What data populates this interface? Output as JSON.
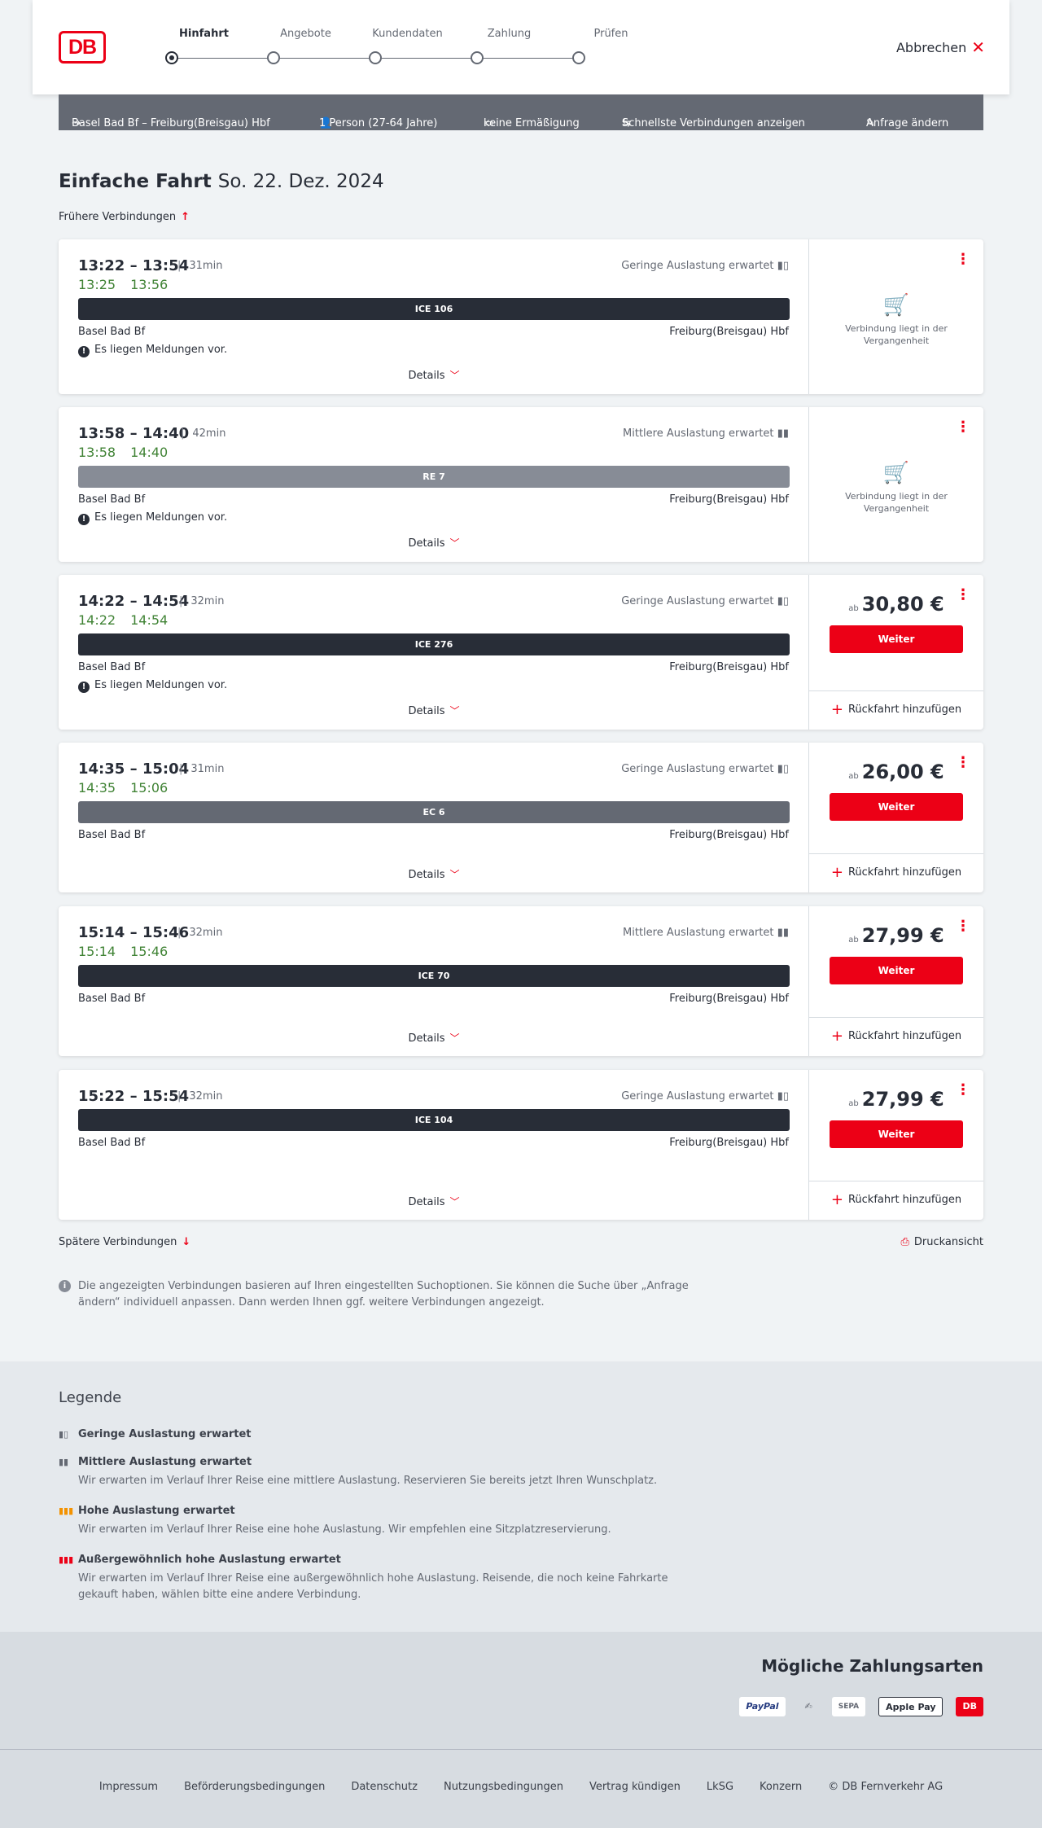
{
  "header": {
    "logo": "DB",
    "steps": [
      "Hinfahrt",
      "Angebote",
      "Kundendaten",
      "Zahlung",
      "Prüfen"
    ],
    "cancel_label": "Abbrechen"
  },
  "query": {
    "route": "Basel Bad Bf – Freiburg(Breisgau) Hbf",
    "passengers": "1 Person (27-64 Jahre)",
    "discount": "keine Ermäßigung",
    "fastest": "Schnellste Verbindungen anzeigen",
    "change": "Anfrage ändern"
  },
  "page": {
    "title": "Einfache Fahrt",
    "date": "So. 22. Dez. 2024",
    "earlier": "Frühere Verbindungen",
    "later": "Spätere Verbindungen",
    "print": "Druckansicht",
    "info": "Die angezeigten Verbindungen basieren auf Ihren eingestellten Suchoptionen. Sie können die Suche über „Anfrage ändern“ individuell anpassen. Dann werden Ihnen ggf. weitere Verbindungen angezeigt."
  },
  "common": {
    "details": "Details",
    "weiter": "Weiter",
    "return": "Rückfahrt hinzufügen",
    "past": "Verbindung liegt in der Vergangenheit",
    "ab": "ab",
    "message": "Es liegen Meldungen vor."
  },
  "connections": [
    {
      "times": "13:22 – 13:54",
      "duration": "31min",
      "rt_dep": "13:25",
      "rt_arr": "13:56",
      "load": "Geringe Auslastung erwartet",
      "train": "ICE 106",
      "from": "Basel Bad Bf",
      "to": "Freiburg(Breisgau) Hbf"
    },
    {
      "times": "13:58 – 14:40",
      "duration": "42min",
      "rt_dep": "13:58",
      "rt_arr": "14:40",
      "load": "Mittlere Auslastung erwartet",
      "train": "RE 7",
      "from": "Basel Bad Bf",
      "to": "Freiburg(Breisgau) Hbf"
    },
    {
      "times": "14:22 – 14:54",
      "duration": "32min",
      "rt_dep": "14:22",
      "rt_arr": "14:54",
      "load": "Geringe Auslastung erwartet",
      "train": "ICE 276",
      "from": "Basel Bad Bf",
      "to": "Freiburg(Breisgau) Hbf",
      "price": "30,80 €"
    },
    {
      "times": "14:35 – 15:04",
      "duration": "31min",
      "rt_dep": "14:35",
      "rt_arr": "15:06",
      "load": "Geringe Auslastung erwartet",
      "train": "EC 6",
      "from": "Basel Bad Bf",
      "to": "Freiburg(Breisgau) Hbf",
      "price": "26,00 €"
    },
    {
      "times": "15:14 – 15:46",
      "duration": "32min",
      "rt_dep": "15:14",
      "rt_arr": "15:46",
      "load": "Mittlere Auslastung erwartet",
      "train": "ICE 70",
      "from": "Basel Bad Bf",
      "to": "Freiburg(Breisgau) Hbf",
      "price": "27,99 €"
    },
    {
      "times": "15:22 – 15:54",
      "duration": "32min",
      "load": "Geringe Auslastung erwartet",
      "train": "ICE 104",
      "from": "Basel Bad Bf",
      "to": "Freiburg(Breisgau) Hbf",
      "price": "27,99 €"
    }
  ],
  "legend": {
    "title": "Legende",
    "items": [
      {
        "title": "Geringe Auslastung erwartet",
        "desc": ""
      },
      {
        "title": "Mittlere Auslastung erwartet",
        "desc": "Wir erwarten im Verlauf Ihrer Reise eine mittlere Auslastung. Reservieren Sie bereits jetzt Ihren Wunschplatz."
      },
      {
        "title": "Hohe Auslastung erwartet",
        "desc": "Wir erwarten im Verlauf Ihrer Reise eine hohe Auslastung. Wir empfehlen eine Sitzplatzreservierung."
      },
      {
        "title": "Außergewöhnlich hohe Auslastung erwartet",
        "desc": "Wir erwarten im Verlauf Ihrer Reise eine außergewöhnlich hohe Auslastung. Reisende, die noch keine Fahrkarte gekauft haben, wählen bitte eine andere Verbindung."
      }
    ]
  },
  "payment": {
    "title": "Mögliche Zahlungsarten",
    "methods": [
      "PayPal",
      "Lastschrift",
      "SEPA",
      "Apple Pay",
      "DB"
    ]
  },
  "footer": {
    "links": [
      "Impressum",
      "Beförderungsbedingungen",
      "Datenschutz",
      "Nutzungsbedingungen",
      "Vertrag kündigen",
      "LkSG",
      "Konzern",
      "© DB Fernverkehr AG"
    ]
  },
  "colors": {
    "brand": "#ec0016",
    "realtime": "#408335",
    "ice": "#282d37",
    "re": "#878c96",
    "ec": "#646973"
  }
}
